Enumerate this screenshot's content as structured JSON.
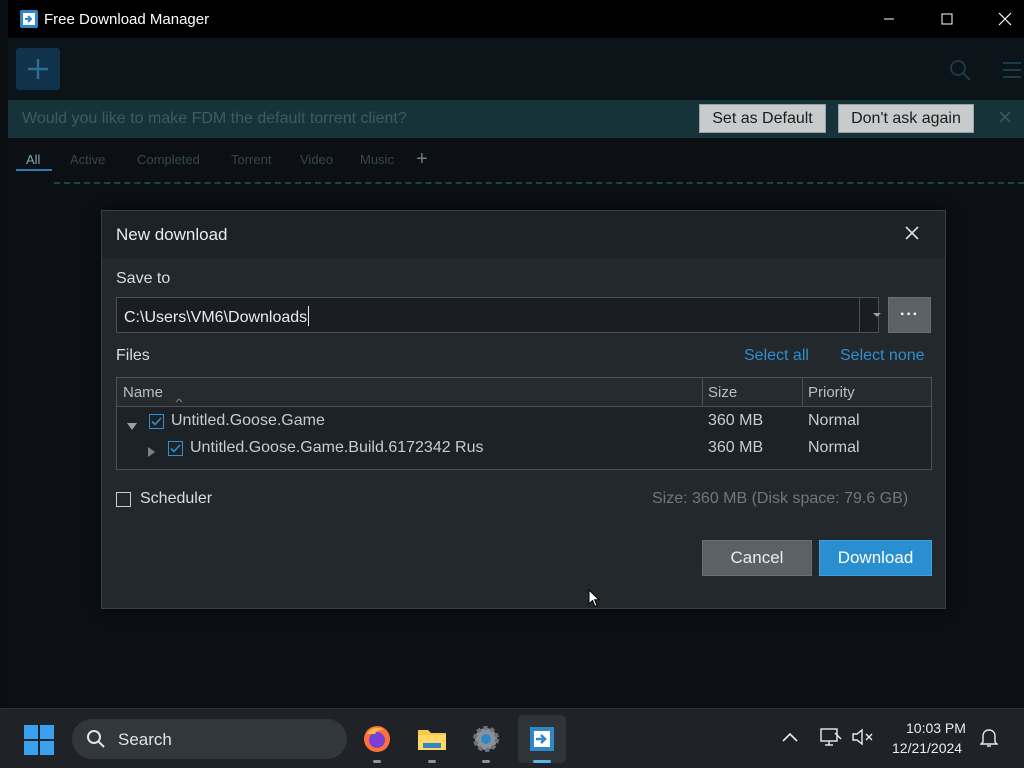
{
  "window": {
    "title": "Free Download Manager"
  },
  "banner": {
    "text": "Would you like to make FDM the default torrent client?",
    "set_default_label": "Set as Default",
    "dont_ask_label": "Don't ask again"
  },
  "tabs": [
    {
      "label": "All"
    },
    {
      "label": "Active"
    },
    {
      "label": "Completed"
    },
    {
      "label": "Torrent"
    },
    {
      "label": "Video"
    },
    {
      "label": "Music"
    }
  ],
  "tab_add_symbol": "+",
  "dialog": {
    "title": "New download",
    "save_to_label": "Save to",
    "path_value": "C:\\Users\\VM6\\Downloads",
    "browse_label": "···",
    "files_label": "Files",
    "select_all_label": "Select all",
    "select_none_label": "Select none",
    "columns": {
      "name": "Name",
      "size": "Size",
      "priority": "Priority"
    },
    "files": [
      {
        "name": "Untitled.Goose.Game",
        "size": "360 MB",
        "priority": "Normal",
        "checked": true,
        "expanded": true
      },
      {
        "name": "Untitled.Goose.Game.Build.6172342 Rus",
        "size": "360 MB",
        "priority": "Normal",
        "checked": true,
        "expanded": false
      }
    ],
    "scheduler_label": "Scheduler",
    "size_info": "Size: 360 MB (Disk space: 79.6 GB)",
    "cancel_label": "Cancel",
    "download_label": "Download"
  },
  "taskbar": {
    "search_label": "Search",
    "time": "10:03 PM",
    "date": "12/21/2024",
    "apps": [
      "firefox-icon",
      "file-explorer-icon",
      "settings-icon",
      "free-download-manager-icon"
    ]
  },
  "colors": {
    "accent": "#2a8fd0",
    "link": "#2f8fcf",
    "dialog_bg": "#23282d"
  }
}
